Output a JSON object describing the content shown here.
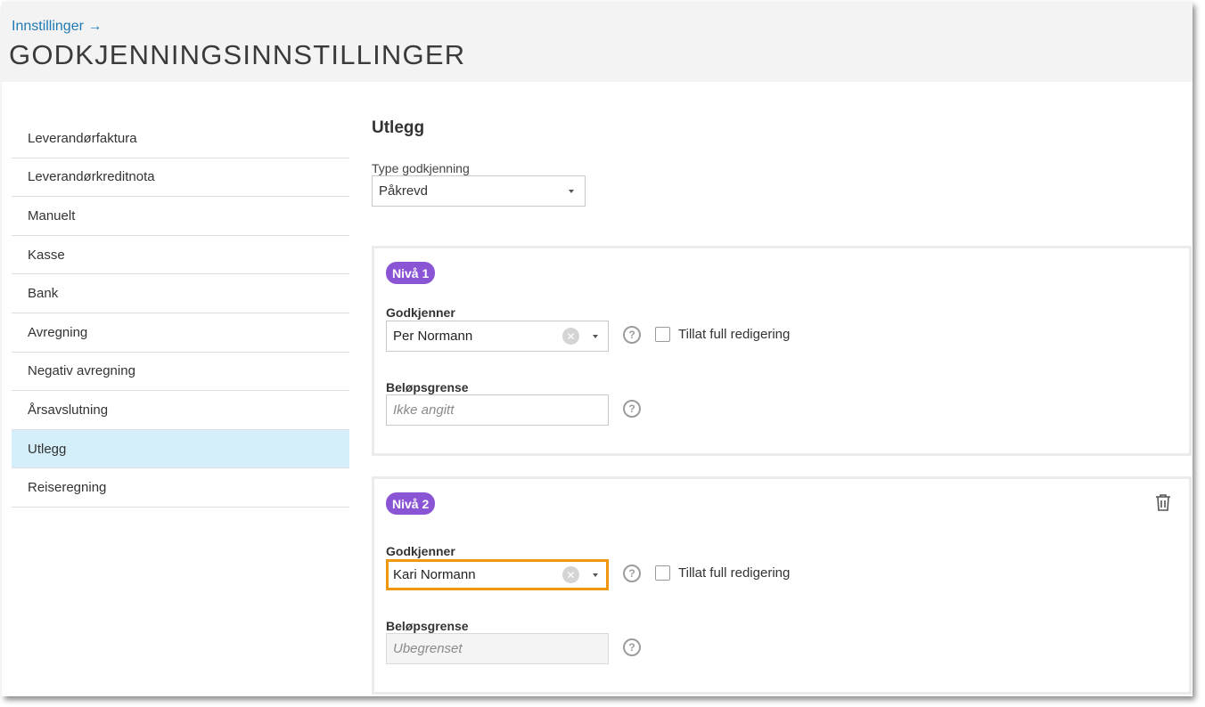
{
  "header": {
    "breadcrumb": "Innstillinger →",
    "title": "GODKJENNINGSINNSTILLINGER"
  },
  "sidebar": {
    "items": [
      {
        "label": "Leverandørfaktura"
      },
      {
        "label": "Leverandørkreditnota"
      },
      {
        "label": "Manuelt"
      },
      {
        "label": "Kasse"
      },
      {
        "label": "Bank"
      },
      {
        "label": "Avregning"
      },
      {
        "label": "Negativ avregning"
      },
      {
        "label": "Årsavslutning"
      },
      {
        "label": "Utlegg",
        "active": true
      },
      {
        "label": "Reiseregning"
      }
    ]
  },
  "main": {
    "section_title": "Utlegg",
    "type_label": "Type godkjenning",
    "type_value": "Påkrevd",
    "levels": [
      {
        "badge": "Nivå 1",
        "approver_label": "Godkjenner",
        "approver_value": "Per Normann",
        "full_edit_label": "Tillat full redigering",
        "full_edit_checked": false,
        "amount_label": "Beløpsgrense",
        "amount_placeholder": "Ikke angitt"
      },
      {
        "badge": "Nivå 2",
        "approver_label": "Godkjenner",
        "approver_value": "Kari Normann",
        "full_edit_label": "Tillat full redigering",
        "full_edit_checked": false,
        "amount_label": "Beløpsgrense",
        "amount_placeholder": "Ubegrenset",
        "amount_disabled": true,
        "has_delete": true
      }
    ]
  },
  "colors": {
    "header_bg": "#f3f3f3",
    "link": "#1f7ab5",
    "active_item_bg": "#d4effa",
    "badge_bg": "#8a55d4",
    "focus_border": "#f0960f"
  },
  "icons": {
    "help": "question-circle-icon",
    "clear": "clear-x-icon",
    "dropdown": "caret-down-icon",
    "delete": "trash-icon"
  }
}
